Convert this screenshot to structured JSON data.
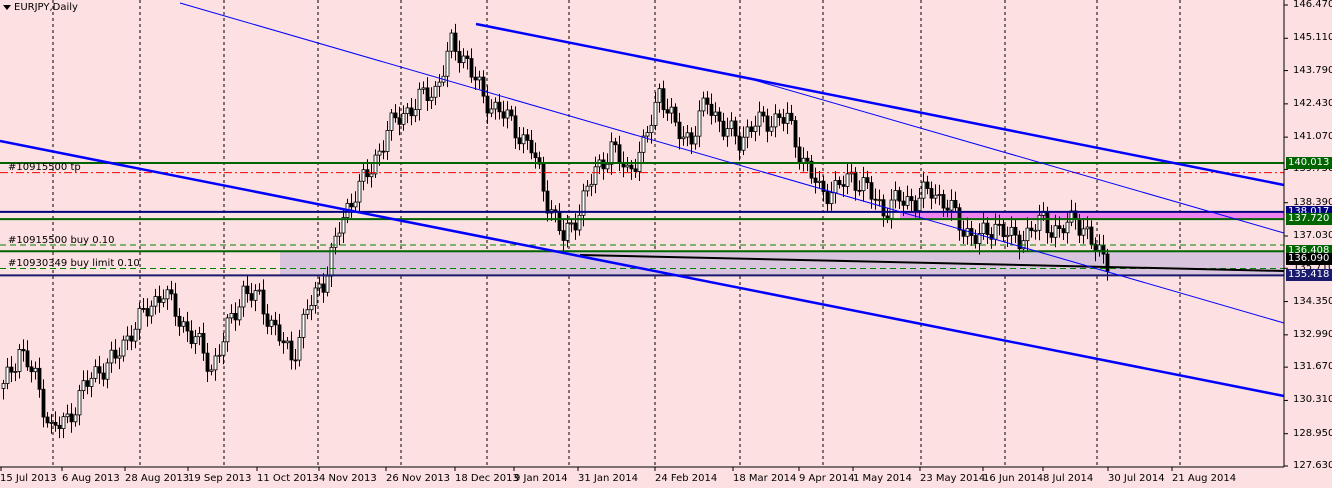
{
  "header": {
    "title": "EURJPY,Daily"
  },
  "colors": {
    "background": "#fde0e1",
    "trendline": "#0000ff",
    "level_green": "#006400",
    "level_navy": "#000080",
    "tp_line": "#ff0000",
    "zone_fill": "#d8c4dc",
    "zone_pink": "#ee82ee"
  },
  "orders": [
    {
      "label": "#10915500 tp"
    },
    {
      "label": "#10915500 buy 0.10"
    },
    {
      "label": "#10930349 buy limit 0.10"
    }
  ],
  "chart_data": {
    "type": "candlestick",
    "symbol": "EURJPY",
    "timeframe": "Daily",
    "ylim": [
      127.63,
      146.47
    ],
    "yticks": [
      "146.470",
      "145.110",
      "143.790",
      "142.430",
      "141.070",
      "139.750",
      "138.390",
      "137.030",
      "135.710",
      "134.350",
      "132.990",
      "131.670",
      "130.310",
      "128.950",
      "127.630"
    ],
    "xticks": [
      "15 Jul 2013",
      "6 Aug 2013",
      "28 Aug 2013",
      "19 Sep 2013",
      "11 Oct 2013",
      "4 Nov 2013",
      "26 Nov 2013",
      "18 Dec 2013",
      "9 Jan 2014",
      "31 Jan 2014",
      "24 Feb 2014",
      "18 Mar 2014",
      "9 Apr 2014",
      "1 May 2014",
      "23 May 2014",
      "16 Jun 2014",
      "8 Jul 2014",
      "30 Jul 2014",
      "21 Aug 2014"
    ],
    "grid": "vertical dashed",
    "series": [
      {
        "values": [
          130.8,
          132.4,
          131.2,
          129.1,
          129.5,
          130.8,
          131.6,
          132.0,
          133.2,
          134.0,
          134.8,
          133.6,
          132.8,
          131.6,
          133.2,
          134.8,
          134.4,
          133.2,
          132.0,
          134.0,
          135.2,
          137.3,
          138.9,
          139.7,
          141.4,
          142.0,
          142.6,
          143.0,
          144.8,
          144.2,
          142.6,
          142.2,
          141.4,
          140.6,
          138.5,
          136.9,
          138.1,
          139.7,
          140.6,
          139.7,
          140.6,
          143.0,
          141.4,
          141.0,
          142.6,
          141.4,
          141.0,
          141.6,
          141.8,
          141.8,
          140.1,
          138.9,
          138.9,
          139.5,
          138.9,
          138.1,
          138.5,
          138.5,
          138.9,
          138.3,
          137.3,
          136.9,
          137.5,
          136.9,
          137.1,
          137.7,
          137.1,
          137.9,
          136.7,
          136.1
        ]
      }
    ],
    "levels": [
      {
        "price": "140.013",
        "color": "#006400"
      },
      {
        "price": "138.017",
        "color": "#000080"
      },
      {
        "price": "137.720",
        "color": "#006400"
      },
      {
        "price": "136.408",
        "color": "#006400"
      },
      {
        "price": "136.090",
        "color": "#000000"
      },
      {
        "price": "135.418",
        "color": "#1a1a6e"
      }
    ]
  }
}
